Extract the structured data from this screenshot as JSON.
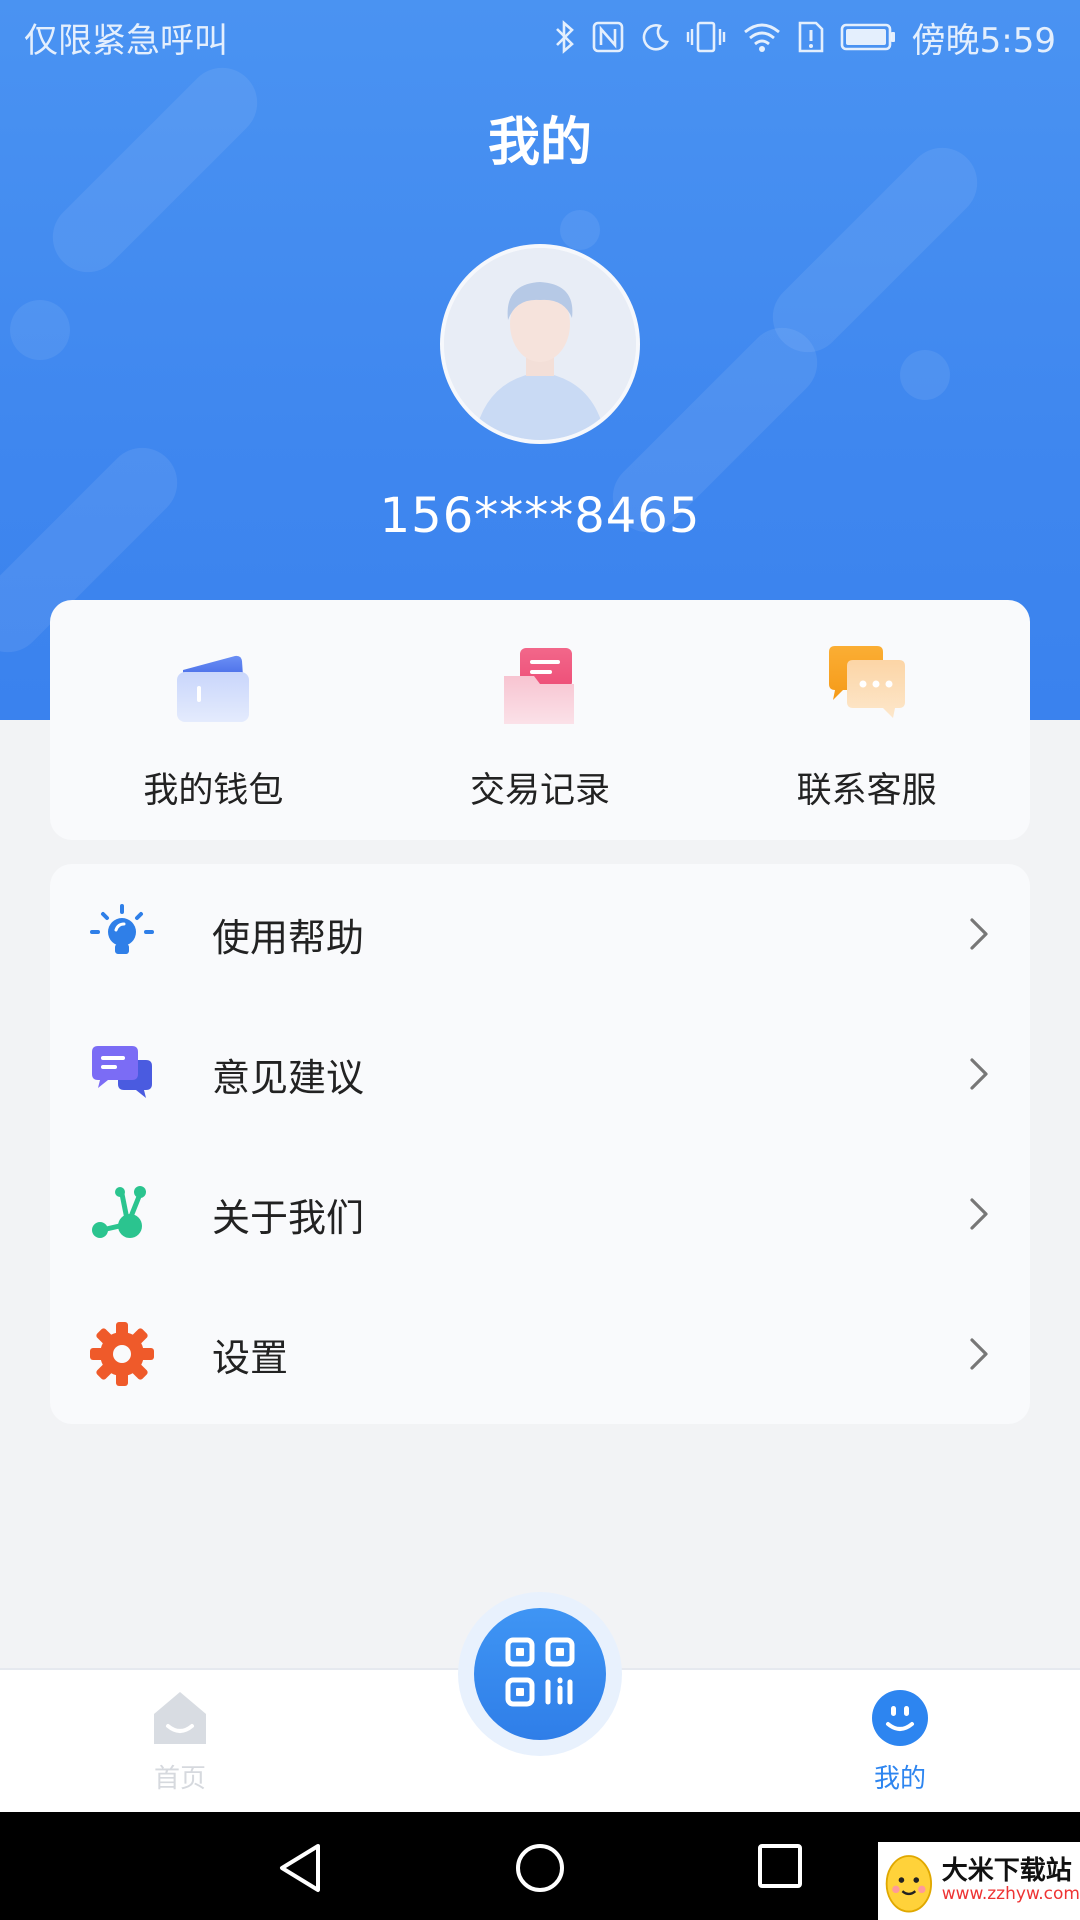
{
  "status_bar": {
    "carrier": "仅限紧急呼叫",
    "time": "傍晚5:59"
  },
  "header": {
    "title": "我的",
    "phone": "156****8465"
  },
  "quick_actions": [
    {
      "label": "我的钱包",
      "icon": "wallet-icon"
    },
    {
      "label": "交易记录",
      "icon": "transaction-record-icon"
    },
    {
      "label": "联系客服",
      "icon": "customer-service-icon"
    }
  ],
  "menu": [
    {
      "label": "使用帮助",
      "icon": "lightbulb-icon"
    },
    {
      "label": "意见建议",
      "icon": "feedback-chat-icon"
    },
    {
      "label": "关于我们",
      "icon": "network-nodes-icon"
    },
    {
      "label": "设置",
      "icon": "gear-icon"
    }
  ],
  "tabbar": {
    "home_label": "首页",
    "mine_label": "我的",
    "active": "mine"
  },
  "watermark": {
    "title": "大米下载站",
    "url": "www.zzhyw.com"
  },
  "colors": {
    "header_blue": "#3f87ef",
    "active_tab": "#2d85f0",
    "settings_orange": "#ef5a2a",
    "help_blue": "#2f7fe8",
    "feedback_purple": "#6a5cf0",
    "about_green": "#2bc48f"
  }
}
